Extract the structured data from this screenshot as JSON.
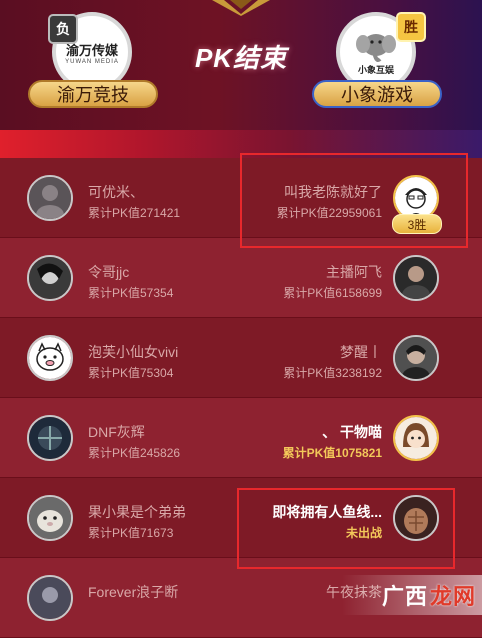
{
  "header": {
    "title": "PK结束",
    "left_team": {
      "name": "渝万竞技",
      "result": "负",
      "logo_main": "渝万传媒",
      "logo_sub": "YUWAN MEDIA"
    },
    "right_team": {
      "name": "小象游戏",
      "result": "胜",
      "logo_main": "小象互娱"
    }
  },
  "rows": [
    {
      "left": {
        "name": "可优米、",
        "pk": "累计PK值271421"
      },
      "right": {
        "name": "叫我老陈就好了",
        "pk": "累计PK值22959061",
        "wins": "3胜"
      }
    },
    {
      "left": {
        "name": "令哥jjc",
        "pk": "累计PK值57354"
      },
      "right": {
        "name": "主播阿飞",
        "pk": "累计PK值6158699"
      }
    },
    {
      "left": {
        "name": "泡芙小仙女vivi",
        "pk": "累计PK值75304"
      },
      "right": {
        "name": "梦醒丨",
        "pk": "累计PK值3238192"
      }
    },
    {
      "left": {
        "name": "DNF灰辉",
        "pk": "累计PK值245826"
      },
      "right": {
        "name": "、 干物喵",
        "pk": "累计PK值1075821"
      }
    },
    {
      "left": {
        "name": "果小果是个弟弟",
        "pk": "累计PK值71673"
      },
      "right": {
        "name": "即将拥有人鱼线...",
        "pk": "未出战"
      }
    },
    {
      "left": {
        "name": "Forever浪子断",
        "pk": ""
      },
      "right": {
        "name": "午夜抹茶",
        "pk": ""
      }
    }
  ],
  "watermark": {
    "text": "广西",
    "accent": "龙网"
  },
  "colors": {
    "background": "#7a1220",
    "highlight_red": "#e8282c",
    "gold": "#f3c85a"
  }
}
